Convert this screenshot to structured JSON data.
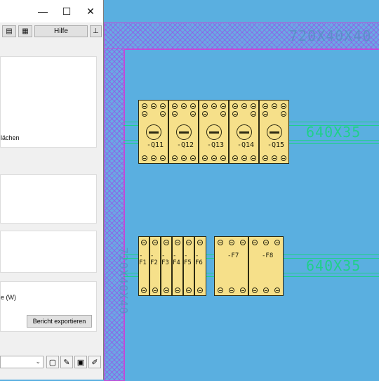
{
  "window": {
    "minimize_glyph": "—",
    "maximize_glyph": "☐",
    "close_glyph": "✕"
  },
  "toolbar": {
    "help_label": "Hilfe",
    "pin_glyph": "⊥"
  },
  "panels": {
    "surfaces_text": "lächen",
    "power_text": "e (W)"
  },
  "actions": {
    "export_label": "Bericht exportieren"
  },
  "bottom": {
    "combo_arrow": "⌄"
  },
  "canvas": {
    "panel_label": "720X40X40",
    "side_label": "720X40X40",
    "rail_top_label": "640X35",
    "rail_bottom_label": "640X35"
  },
  "devices": {
    "top_row": [
      "-Q11",
      "-Q12",
      "-Q13",
      "-Q14",
      "-Q15"
    ],
    "bottom_row_a": [
      "-F1",
      "-F2",
      "-F3",
      "-F4",
      "-F5",
      "-F6"
    ],
    "bottom_row_b": [
      "-F7",
      "-F8"
    ]
  },
  "colors": {
    "canvas": "#5aafe0",
    "hatch": "#a03ce6",
    "rail": "#1fd08a",
    "device": "#f6e08a"
  }
}
